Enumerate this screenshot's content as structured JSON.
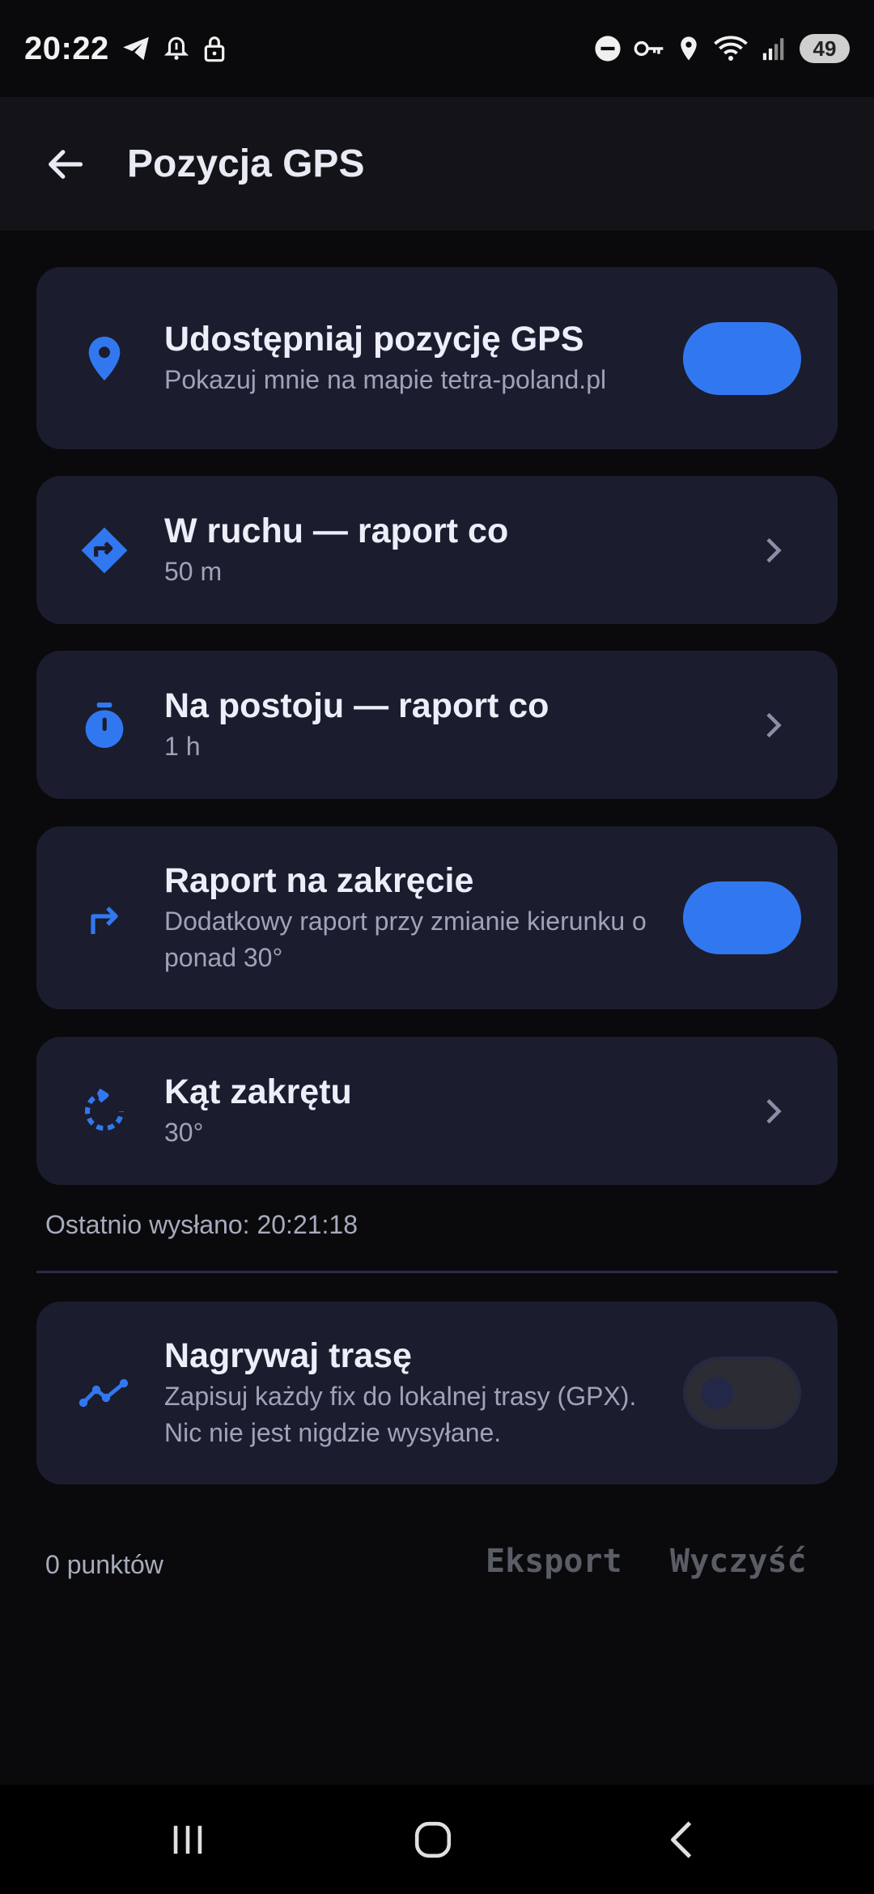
{
  "status_bar": {
    "time": "20:22",
    "battery": "49",
    "left_icons": [
      "telegram-icon",
      "alarm-icon",
      "lock-icon"
    ],
    "right_icons": [
      "dnd-icon",
      "key-icon",
      "location-icon",
      "wifi-icon",
      "signal-icon"
    ]
  },
  "app_bar": {
    "title": "Pozycja GPS"
  },
  "settings": {
    "share_gps": {
      "title": "Udostępniaj pozycję GPS",
      "subtitle": "Pokazuj mnie na mapie tetra-poland.pl",
      "enabled": true
    },
    "moving_interval": {
      "title": "W ruchu — raport co",
      "value": "50 m"
    },
    "stationary_interval": {
      "title": "Na postoju — raport co",
      "value": "1 h"
    },
    "turn_report": {
      "title": "Raport na zakręcie",
      "subtitle_line1": "Dodatkowy raport przy zmianie kierunku o",
      "subtitle_line2": "ponad 30°",
      "enabled": true
    },
    "turn_angle": {
      "title": "Kąt zakrętu",
      "value": "30°"
    }
  },
  "last_sent": "Ostatnio wysłano: 20:21:18",
  "record_track": {
    "title": "Nagrywaj trasę",
    "subtitle_line1": "Zapisuj każdy fix do lokalnej trasy (GPX).",
    "subtitle_line2": "Nic nie jest nigdzie wysyłane.",
    "enabled": false
  },
  "track_footer": {
    "points": "0 punktów",
    "export_label": "Eksport",
    "clear_label": "Wyczyść"
  },
  "colors": {
    "accent": "#3178f0",
    "card_bg": "#1b1c2e",
    "background": "#0a0a0c"
  }
}
